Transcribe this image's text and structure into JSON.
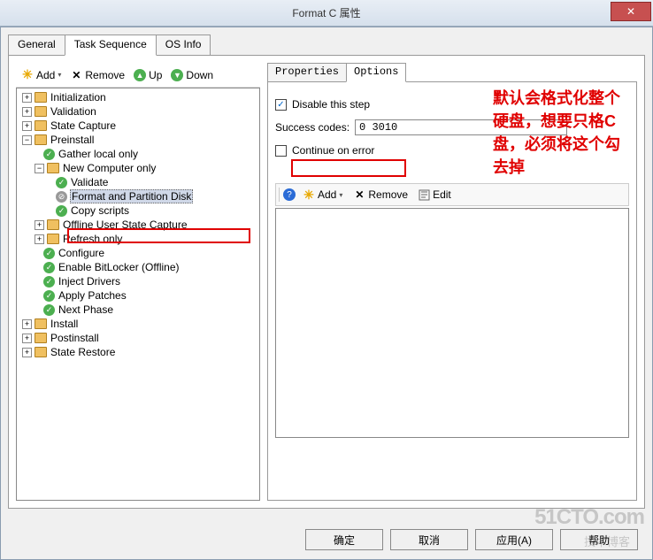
{
  "window": {
    "title": "Format C 属性",
    "close": "✕"
  },
  "tabs": {
    "general": "General",
    "taskseq": "Task Sequence",
    "osinfo": "OS Info"
  },
  "toolbar": {
    "add": "Add",
    "remove": "Remove",
    "up": "Up",
    "down": "Down"
  },
  "tree": {
    "initialization": "Initialization",
    "validation": "Validation",
    "statecapture": "State Capture",
    "preinstall": "Preinstall",
    "gatherlocal": "Gather local only",
    "newcomp": "New Computer only",
    "validate": "Validate",
    "formatpart": "Format and Partition Disk",
    "copyscripts": "Copy scripts",
    "offlineusc": "Offline User State Capture",
    "refreshonly": "Refresh only",
    "configure": "Configure",
    "bitlocker": "Enable BitLocker (Offline)",
    "injectdrv": "Inject Drivers",
    "applypatches": "Apply Patches",
    "nextphase": "Next Phase",
    "install": "Install",
    "postinstall": "Postinstall",
    "staterestore": "State Restore"
  },
  "subtabs": {
    "properties": "Properties",
    "options": "Options"
  },
  "options": {
    "disable_step": "Disable this step",
    "success_codes_label": "Success codes:",
    "success_codes_value": "0 3010",
    "continue_on_error": "Continue on error"
  },
  "inner_toolbar": {
    "add": "Add",
    "remove": "Remove",
    "edit": "Edit"
  },
  "annotation": "默认会格式化整个硬盘，想要只格C盘，必须将这个勾去掉",
  "buttons": {
    "ok": "确定",
    "cancel": "取消",
    "apply": "应用(A)",
    "help": "帮助"
  },
  "watermark": {
    "main": "51CTO.com",
    "sub": "技术博客"
  }
}
